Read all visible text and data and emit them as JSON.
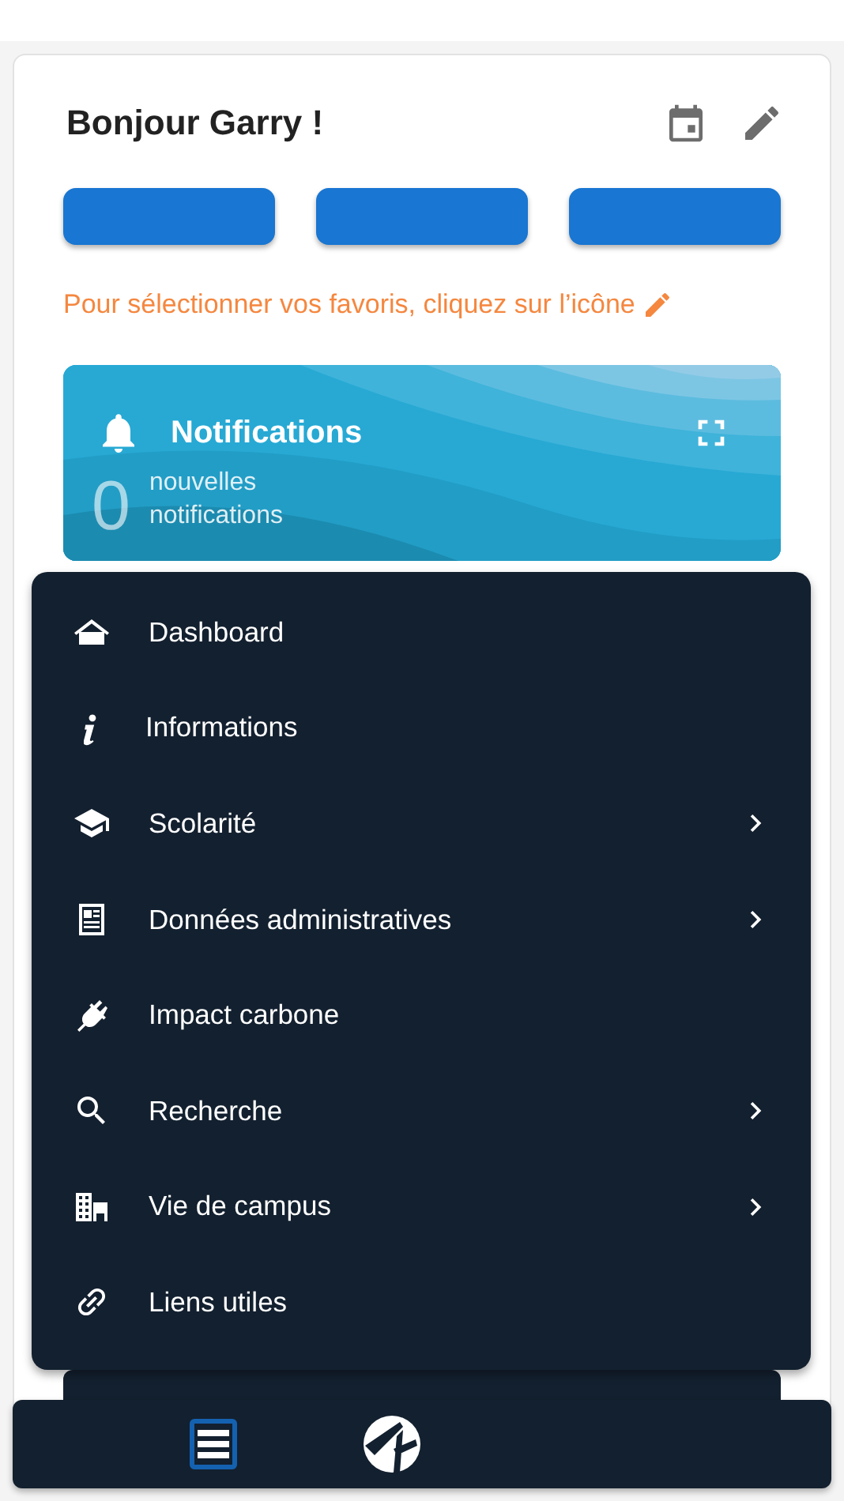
{
  "greeting": "Bonjour Garry !",
  "favorite_buttons": [
    {
      "kind": "empty"
    },
    {
      "kind": "empty"
    },
    {
      "kind": "empty"
    }
  ],
  "hint": "Pour sélectionner vos favoris, cliquez sur l’icône",
  "notifications": {
    "title": "Notifications",
    "count": "0",
    "label_lines": [
      "nouvelles",
      "notifications"
    ]
  },
  "menu": {
    "items": [
      {
        "label": "Dashboard",
        "has_submenu": false
      },
      {
        "label": "Informations",
        "has_submenu": false
      },
      {
        "label": "Scolarité",
        "has_submenu": true
      },
      {
        "label": "Données administratives",
        "has_submenu": true
      },
      {
        "label": "Impact carbone",
        "has_submenu": false
      },
      {
        "label": "Recherche",
        "has_submenu": true
      },
      {
        "label": "Vie de campus",
        "has_submenu": true
      },
      {
        "label": "Liens utiles",
        "has_submenu": false
      }
    ]
  },
  "bottom_nav": [
    {
      "kind": "menu",
      "selected": true
    },
    {
      "kind": "logo",
      "selected": false
    }
  ]
}
